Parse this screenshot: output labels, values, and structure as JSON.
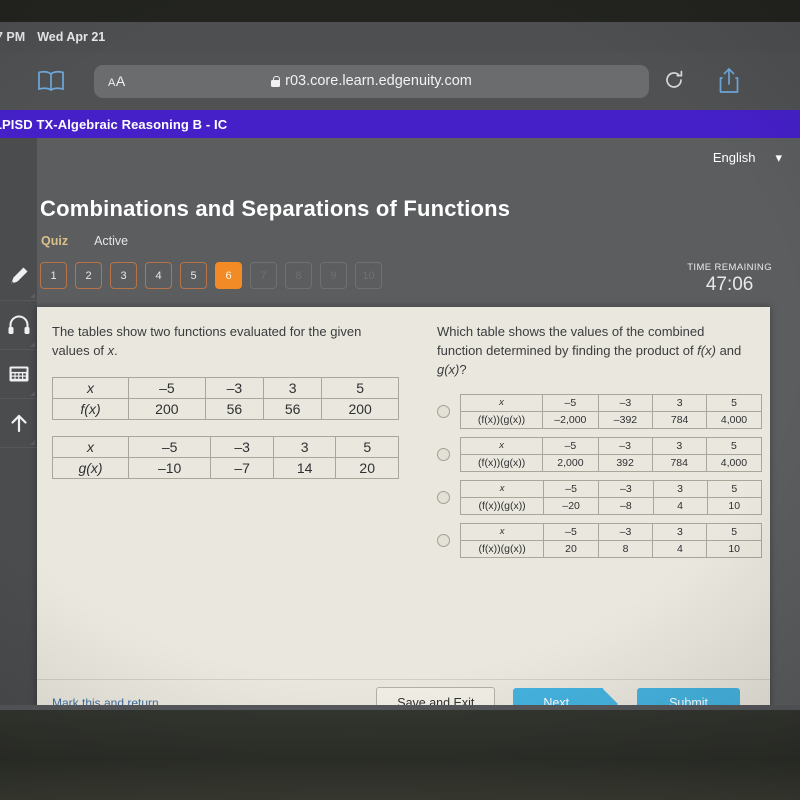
{
  "status_bar": {
    "clock": "7 PM",
    "date": "Wed Apr 21"
  },
  "browser": {
    "reader_icon": "book-icon",
    "text_size_label": "AA",
    "url": "r03.core.learn.edgenuity.com",
    "lock_icon": "lock-icon",
    "reload_icon": "reload-icon",
    "share_icon": "share-icon"
  },
  "course_bar": {
    "title": "LPISD TX-Algebraic Reasoning B - IC",
    "accent_color": "#4520c9"
  },
  "app_header": {
    "language": "English",
    "language_chevron": "chevron-down-icon",
    "assignment_title": "Combinations and Separations of Functions",
    "activity_kind": "Quiz",
    "activity_state": "Active",
    "kind_color": "#d9c18a",
    "time_remaining_label": "TIME REMAINING",
    "time_remaining_value": "47:06",
    "current_color": "#f28b25"
  },
  "question_nav": [
    {
      "label": "1",
      "state": "answered"
    },
    {
      "label": "2",
      "state": "answered"
    },
    {
      "label": "3",
      "state": "answered"
    },
    {
      "label": "4",
      "state": "answered"
    },
    {
      "label": "5",
      "state": "answered"
    },
    {
      "label": "6",
      "state": "current"
    },
    {
      "label": "7",
      "state": "locked"
    },
    {
      "label": "8",
      "state": "locked"
    },
    {
      "label": "9",
      "state": "locked"
    },
    {
      "label": "10",
      "state": "locked"
    }
  ],
  "tool_rail": [
    {
      "icon": "highlighter-icon"
    },
    {
      "icon": "headphones-icon"
    },
    {
      "icon": "calculator-icon"
    },
    {
      "icon": "arrow-up-icon"
    }
  ],
  "question": {
    "stem_line_1": "The tables show two functions evaluated for the given",
    "stem_line_2": "values of ",
    "stem_line_2_italic": "x",
    "stem_line_2_end": ".",
    "prompt_line_1": "Which table shows the values of the combined",
    "prompt_line_2a": "function determined by finding the product of ",
    "prompt_line_2b": "f(x)",
    "prompt_line_2c": " and",
    "prompt_line_3a": "g(x)",
    "prompt_line_3b": "?",
    "given_tables": [
      {
        "row_label_x": "x",
        "row_label_fn": "f(x)",
        "x_values": [
          "–5",
          "–3",
          "3",
          "5"
        ],
        "fn_values": [
          "200",
          "56",
          "56",
          "200"
        ]
      },
      {
        "row_label_x": "x",
        "row_label_fn": "g(x)",
        "x_values": [
          "–5",
          "–3",
          "3",
          "5"
        ],
        "fn_values": [
          "–10",
          "–7",
          "14",
          "20"
        ]
      }
    ],
    "choices": [
      {
        "row_label_x": "x",
        "row_label_fn": "(f(x))(g(x))",
        "x_values": [
          "–5",
          "–3",
          "3",
          "5"
        ],
        "fn_values": [
          "–2,000",
          "–392",
          "784",
          "4,000"
        ],
        "selected": false
      },
      {
        "row_label_x": "x",
        "row_label_fn": "(f(x))(g(x))",
        "x_values": [
          "–5",
          "–3",
          "3",
          "5"
        ],
        "fn_values": [
          "2,000",
          "392",
          "784",
          "4,000"
        ],
        "selected": false
      },
      {
        "row_label_x": "x",
        "row_label_fn": "(f(x))(g(x))",
        "x_values": [
          "–5",
          "–3",
          "3",
          "5"
        ],
        "fn_values": [
          "–20",
          "–8",
          "4",
          "10"
        ],
        "selected": false
      },
      {
        "row_label_x": "x",
        "row_label_fn": "(f(x))(g(x))",
        "x_values": [
          "–5",
          "–3",
          "3",
          "5"
        ],
        "fn_values": [
          "20",
          "8",
          "4",
          "10"
        ],
        "selected": false
      }
    ]
  },
  "footer": {
    "mark_link": "Mark this and return",
    "save_label": "Save and Exit",
    "next_label": "Next",
    "submit_label": "Submit",
    "primary_color": "#45b3e0"
  }
}
